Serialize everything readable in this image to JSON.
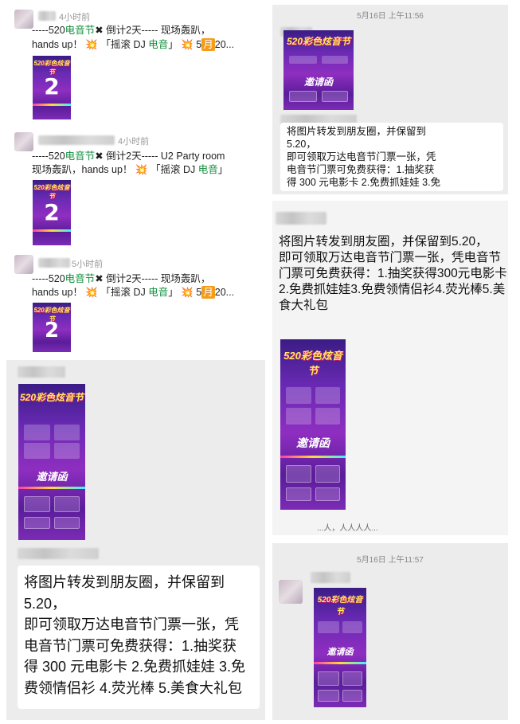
{
  "moments": {
    "posts": [
      {
        "time": "4小时前",
        "line1": {
          "pre": "-----520",
          "hl": "电音节",
          "mark": "✖",
          "post": "倒计2",
          "tail": "天----- 现场轰趴，"
        },
        "line2": {
          "a": "hands up！",
          "star": "💥",
          "b": "「摇滚 DJ ",
          "hl": "电音",
          "c": "」",
          "star2": "💥",
          "d": "5",
          "badge": "月",
          "e": "20..."
        },
        "poster_title": "520彩色炫音节",
        "poster_big": "2"
      },
      {
        "time": "4小时前",
        "line1": {
          "pre": "-----520",
          "hl": "电音节",
          "mark": "✖",
          "post": "倒计2",
          "tail": "天----- U2 Party room"
        },
        "line2": {
          "a": "现场轰趴，hands up！",
          "star": "💥",
          "b": "「摇滚 DJ ",
          "hl": "电音",
          "c": "」",
          "star2": "",
          "d": "",
          "badge": "",
          "e": ""
        },
        "poster_title": "520彩色炫音节",
        "poster_big": "2"
      },
      {
        "time": "5小时前",
        "line1": {
          "pre": "-----520",
          "hl": "电音节",
          "mark": "✖",
          "post": "倒计2",
          "tail": "天----- 现场轰趴，"
        },
        "line2": {
          "a": "hands up！",
          "star": "💥",
          "b": "「摇滚 DJ ",
          "hl": "电音",
          "c": "」",
          "star2": "💥",
          "d": "5",
          "badge": "月",
          "e": "20..."
        },
        "poster_title": "520彩色炫音节",
        "poster_big": "2"
      }
    ]
  },
  "chat_a": {
    "poster_title": "520彩色炫音节",
    "poster_invite": "邀请函",
    "message_lines": [
      "将图片转发到朋友圈，并保留到",
      "5.20，",
      "即可领取万达电音节门票一张，凭",
      "电音节门票可免费获得：1.抽奖获",
      "得 300 元电影卡 2.免费抓娃娃 3.免",
      "费领情侣衫 4.荧光棒 5.美食大礼包"
    ]
  },
  "chat_b": {
    "timestamp": "5月16日 上午11:56",
    "poster_title": "520彩色炫音节",
    "poster_invite": "邀请函",
    "message_lines": [
      "将图片转发到朋友圈，并保留到",
      "5.20，",
      "即可领取万达电音节门票一张，凭",
      "电音节门票可免费获得：1.抽奖获",
      "得 300 元电影卡 2.免费抓娃娃 3.免",
      "费领情侣衫 4.荧光棒 5.美食大礼包"
    ]
  },
  "chat_c": {
    "message_lines": [
      "将图片转发到朋友圈，并保留到5.20，",
      "即可领取万达电音节门票一张，凭电音节",
      "门票可免费获得：1.抽奖获得300元电影卡",
      "2.免费抓娃娃3.免费领情侣衫4.荧光棒5.美",
      "食大礼包"
    ],
    "poster_title": "520彩色炫音节",
    "poster_invite": "邀请函",
    "fragment": "...人，人人人人..."
  },
  "chat_d": {
    "timestamp": "5月16日 上午11:57",
    "poster_title": "520彩色炫音节",
    "poster_invite": "邀请函"
  }
}
